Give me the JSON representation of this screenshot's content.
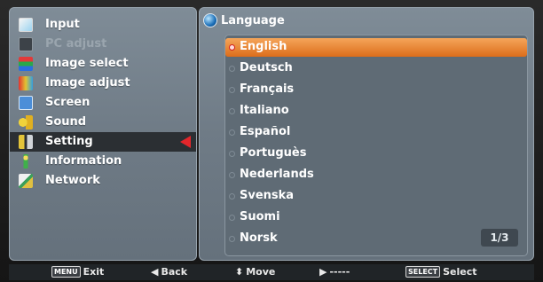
{
  "menu": {
    "items": [
      {
        "label": "Input",
        "icon": "input-icon",
        "disabled": false,
        "selected": false
      },
      {
        "label": "PC adjust",
        "icon": "pc-adjust-icon",
        "disabled": true,
        "selected": false
      },
      {
        "label": "Image select",
        "icon": "image-select-icon",
        "disabled": false,
        "selected": false
      },
      {
        "label": "Image adjust",
        "icon": "image-adjust-icon",
        "disabled": false,
        "selected": false
      },
      {
        "label": "Screen",
        "icon": "screen-icon",
        "disabled": false,
        "selected": false
      },
      {
        "label": "Sound",
        "icon": "sound-icon",
        "disabled": false,
        "selected": false
      },
      {
        "label": "Setting",
        "icon": "setting-icon",
        "disabled": false,
        "selected": true
      },
      {
        "label": "Information",
        "icon": "information-icon",
        "disabled": false,
        "selected": false
      },
      {
        "label": "Network",
        "icon": "network-icon",
        "disabled": false,
        "selected": false
      }
    ]
  },
  "submenu": {
    "title": "Language",
    "options": [
      "English",
      "Deutsch",
      "Français",
      "Italiano",
      "Español",
      "Portuguès",
      "Nederlands",
      "Svenska",
      "Suomi",
      "Norsk"
    ],
    "selected_index": 0,
    "page": "1/3"
  },
  "help": {
    "exit_key": "MENU",
    "exit": "Exit",
    "back": "Back",
    "move": "Move",
    "next": "-----",
    "select_key": "SELECT",
    "select": "Select"
  },
  "colors": {
    "panel": "#6f7b86",
    "highlight": "#e27a2b",
    "selected_menu": "#2b2f33",
    "arrow": "#e3262b"
  }
}
